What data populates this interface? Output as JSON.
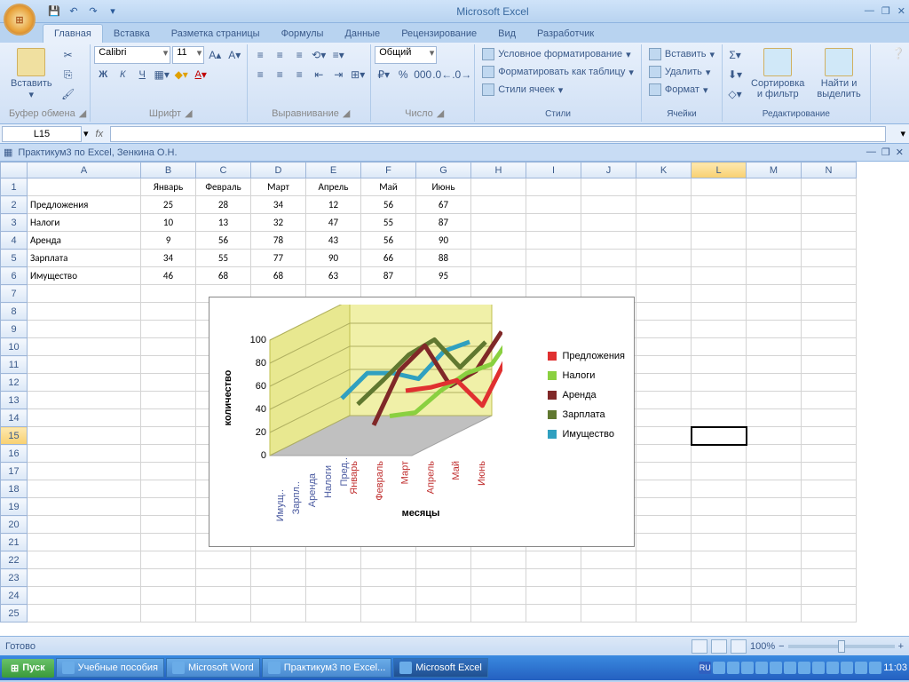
{
  "app_title": "Microsoft Excel",
  "tabs": [
    "Главная",
    "Вставка",
    "Разметка страницы",
    "Формулы",
    "Данные",
    "Рецензирование",
    "Вид",
    "Разработчик"
  ],
  "active_tab": "Главная",
  "groups": {
    "clipboard": "Буфер обмена",
    "font": "Шрифт",
    "align": "Выравнивание",
    "number": "Число",
    "styles": "Стили",
    "cells": "Ячейки",
    "edit": "Редактирование"
  },
  "paste": "Вставить",
  "font_name": "Calibri",
  "font_size": "11",
  "number_format": "Общий",
  "styles": {
    "cond": "Условное форматирование",
    "table": "Форматировать как таблицу",
    "cell": "Стили ячеек"
  },
  "cells": {
    "insert": "Вставить",
    "delete": "Удалить",
    "format": "Формат"
  },
  "edit": {
    "sort": "Сортировка\nи фильтр",
    "find": "Найти и\nвыделить"
  },
  "name_box": "L15",
  "workbook": "Практикум3 по Excel, Зенкина О.Н.",
  "columns": [
    "A",
    "B",
    "C",
    "D",
    "E",
    "F",
    "G",
    "H",
    "I",
    "J",
    "K",
    "L",
    "M",
    "N"
  ],
  "wide_col": "A",
  "selected_col": "L",
  "selected_row": "15",
  "rows": [
    "1",
    "2",
    "3",
    "4",
    "5",
    "6",
    "7",
    "8",
    "9",
    "10",
    "11",
    "12",
    "13",
    "14",
    "15",
    "16",
    "17",
    "18",
    "19",
    "20",
    "21",
    "22",
    "23",
    "24",
    "25"
  ],
  "months": [
    "Январь",
    "Февраль",
    "Март",
    "Апрель",
    "Май",
    "Июнь"
  ],
  "data_rows": [
    {
      "label": "Предложения",
      "vals": [
        25,
        28,
        34,
        12,
        56,
        67
      ]
    },
    {
      "label": "Налоги",
      "vals": [
        10,
        13,
        32,
        47,
        55,
        87
      ]
    },
    {
      "label": "Аренда",
      "vals": [
        9,
        56,
        78,
        43,
        56,
        90
      ]
    },
    {
      "label": "Зарплата",
      "vals": [
        34,
        55,
        77,
        90,
        66,
        88
      ]
    },
    {
      "label": "Имущество",
      "vals": [
        46,
        68,
        68,
        63,
        87,
        95
      ]
    }
  ],
  "chart_data": {
    "type": "line",
    "title": "",
    "xlabel": "месяцы",
    "ylabel": "количество",
    "ylim": [
      0,
      100
    ],
    "yticks": [
      0,
      20,
      40,
      60,
      80,
      100
    ],
    "categories": [
      "Январь",
      "Февраль",
      "Март",
      "Апрель",
      "Май",
      "Июнь"
    ],
    "depth_categories": [
      "Имущ..",
      "Зарпл..",
      "Аренда",
      "Налоги",
      "Пред.."
    ],
    "series": [
      {
        "name": "Предложения",
        "color": "#e03030",
        "values": [
          25,
          28,
          34,
          12,
          56,
          67
        ]
      },
      {
        "name": "Налоги",
        "color": "#8ad040",
        "values": [
          10,
          13,
          32,
          47,
          55,
          87
        ]
      },
      {
        "name": "Аренда",
        "color": "#802828",
        "values": [
          9,
          56,
          78,
          43,
          56,
          90
        ]
      },
      {
        "name": "Зарплата",
        "color": "#607830",
        "values": [
          34,
          55,
          77,
          90,
          66,
          88
        ]
      },
      {
        "name": "Имущество",
        "color": "#30a0c0",
        "values": [
          46,
          68,
          68,
          63,
          87,
          95
        ]
      }
    ]
  },
  "status": "Готово",
  "zoom": "100%",
  "taskbar": {
    "start": "Пуск",
    "items": [
      "Учебные пособия",
      "Microsoft Word",
      "Практикум3 по Excel...",
      "Microsoft Excel"
    ],
    "active_item": "Microsoft Excel",
    "lang": "RU",
    "time": "11:03"
  }
}
